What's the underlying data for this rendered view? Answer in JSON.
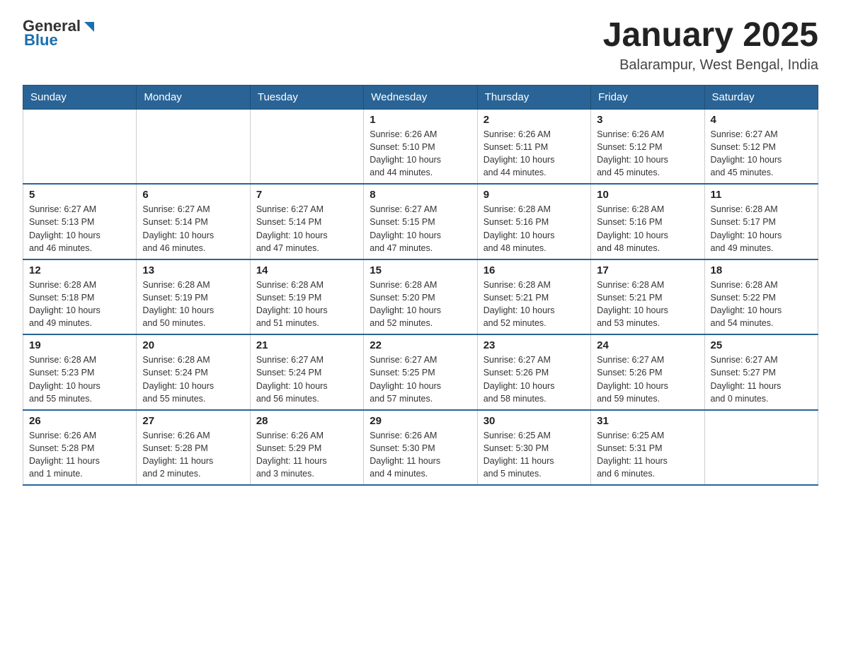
{
  "header": {
    "logo_general": "General",
    "logo_blue": "Blue",
    "title": "January 2025",
    "subtitle": "Balarampur, West Bengal, India"
  },
  "days_of_week": [
    "Sunday",
    "Monday",
    "Tuesday",
    "Wednesday",
    "Thursday",
    "Friday",
    "Saturday"
  ],
  "weeks": [
    {
      "days": [
        {
          "number": "",
          "info": ""
        },
        {
          "number": "",
          "info": ""
        },
        {
          "number": "",
          "info": ""
        },
        {
          "number": "1",
          "info": "Sunrise: 6:26 AM\nSunset: 5:10 PM\nDaylight: 10 hours\nand 44 minutes."
        },
        {
          "number": "2",
          "info": "Sunrise: 6:26 AM\nSunset: 5:11 PM\nDaylight: 10 hours\nand 44 minutes."
        },
        {
          "number": "3",
          "info": "Sunrise: 6:26 AM\nSunset: 5:12 PM\nDaylight: 10 hours\nand 45 minutes."
        },
        {
          "number": "4",
          "info": "Sunrise: 6:27 AM\nSunset: 5:12 PM\nDaylight: 10 hours\nand 45 minutes."
        }
      ]
    },
    {
      "days": [
        {
          "number": "5",
          "info": "Sunrise: 6:27 AM\nSunset: 5:13 PM\nDaylight: 10 hours\nand 46 minutes."
        },
        {
          "number": "6",
          "info": "Sunrise: 6:27 AM\nSunset: 5:14 PM\nDaylight: 10 hours\nand 46 minutes."
        },
        {
          "number": "7",
          "info": "Sunrise: 6:27 AM\nSunset: 5:14 PM\nDaylight: 10 hours\nand 47 minutes."
        },
        {
          "number": "8",
          "info": "Sunrise: 6:27 AM\nSunset: 5:15 PM\nDaylight: 10 hours\nand 47 minutes."
        },
        {
          "number": "9",
          "info": "Sunrise: 6:28 AM\nSunset: 5:16 PM\nDaylight: 10 hours\nand 48 minutes."
        },
        {
          "number": "10",
          "info": "Sunrise: 6:28 AM\nSunset: 5:16 PM\nDaylight: 10 hours\nand 48 minutes."
        },
        {
          "number": "11",
          "info": "Sunrise: 6:28 AM\nSunset: 5:17 PM\nDaylight: 10 hours\nand 49 minutes."
        }
      ]
    },
    {
      "days": [
        {
          "number": "12",
          "info": "Sunrise: 6:28 AM\nSunset: 5:18 PM\nDaylight: 10 hours\nand 49 minutes."
        },
        {
          "number": "13",
          "info": "Sunrise: 6:28 AM\nSunset: 5:19 PM\nDaylight: 10 hours\nand 50 minutes."
        },
        {
          "number": "14",
          "info": "Sunrise: 6:28 AM\nSunset: 5:19 PM\nDaylight: 10 hours\nand 51 minutes."
        },
        {
          "number": "15",
          "info": "Sunrise: 6:28 AM\nSunset: 5:20 PM\nDaylight: 10 hours\nand 52 minutes."
        },
        {
          "number": "16",
          "info": "Sunrise: 6:28 AM\nSunset: 5:21 PM\nDaylight: 10 hours\nand 52 minutes."
        },
        {
          "number": "17",
          "info": "Sunrise: 6:28 AM\nSunset: 5:21 PM\nDaylight: 10 hours\nand 53 minutes."
        },
        {
          "number": "18",
          "info": "Sunrise: 6:28 AM\nSunset: 5:22 PM\nDaylight: 10 hours\nand 54 minutes."
        }
      ]
    },
    {
      "days": [
        {
          "number": "19",
          "info": "Sunrise: 6:28 AM\nSunset: 5:23 PM\nDaylight: 10 hours\nand 55 minutes."
        },
        {
          "number": "20",
          "info": "Sunrise: 6:28 AM\nSunset: 5:24 PM\nDaylight: 10 hours\nand 55 minutes."
        },
        {
          "number": "21",
          "info": "Sunrise: 6:27 AM\nSunset: 5:24 PM\nDaylight: 10 hours\nand 56 minutes."
        },
        {
          "number": "22",
          "info": "Sunrise: 6:27 AM\nSunset: 5:25 PM\nDaylight: 10 hours\nand 57 minutes."
        },
        {
          "number": "23",
          "info": "Sunrise: 6:27 AM\nSunset: 5:26 PM\nDaylight: 10 hours\nand 58 minutes."
        },
        {
          "number": "24",
          "info": "Sunrise: 6:27 AM\nSunset: 5:26 PM\nDaylight: 10 hours\nand 59 minutes."
        },
        {
          "number": "25",
          "info": "Sunrise: 6:27 AM\nSunset: 5:27 PM\nDaylight: 11 hours\nand 0 minutes."
        }
      ]
    },
    {
      "days": [
        {
          "number": "26",
          "info": "Sunrise: 6:26 AM\nSunset: 5:28 PM\nDaylight: 11 hours\nand 1 minute."
        },
        {
          "number": "27",
          "info": "Sunrise: 6:26 AM\nSunset: 5:28 PM\nDaylight: 11 hours\nand 2 minutes."
        },
        {
          "number": "28",
          "info": "Sunrise: 6:26 AM\nSunset: 5:29 PM\nDaylight: 11 hours\nand 3 minutes."
        },
        {
          "number": "29",
          "info": "Sunrise: 6:26 AM\nSunset: 5:30 PM\nDaylight: 11 hours\nand 4 minutes."
        },
        {
          "number": "30",
          "info": "Sunrise: 6:25 AM\nSunset: 5:30 PM\nDaylight: 11 hours\nand 5 minutes."
        },
        {
          "number": "31",
          "info": "Sunrise: 6:25 AM\nSunset: 5:31 PM\nDaylight: 11 hours\nand 6 minutes."
        },
        {
          "number": "",
          "info": ""
        }
      ]
    }
  ]
}
